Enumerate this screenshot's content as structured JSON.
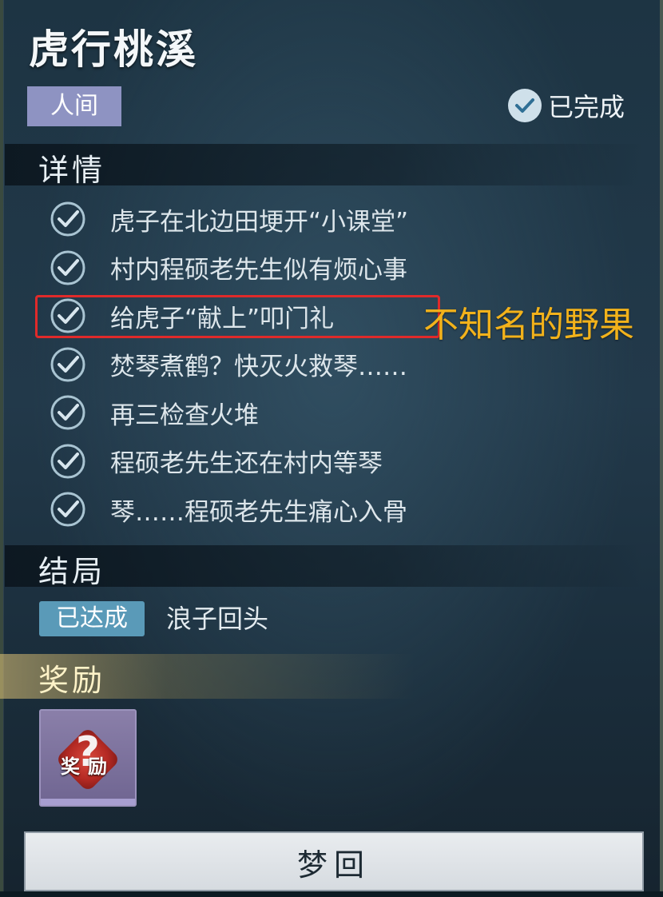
{
  "quest": {
    "title": "虎行桃溪",
    "category_tag": "人间",
    "status_label": "已完成"
  },
  "details": {
    "heading": "详情",
    "tasks": [
      {
        "text": "虎子在北边田埂开“小课堂”",
        "done": true
      },
      {
        "text": "村内程硕老先生似有烦心事",
        "done": true
      },
      {
        "text": "给虎子“献上”叩门礼",
        "done": true
      },
      {
        "text": "焚琴煮鹤？快灭火救琴……",
        "done": true
      },
      {
        "text": "再三检查火堆",
        "done": true
      },
      {
        "text": "程硕老先生还在村内等琴",
        "done": true
      },
      {
        "text": "琴……程硕老先生痛心入骨",
        "done": true
      }
    ]
  },
  "annotation": {
    "text": "不知名的野果",
    "highlight_color": "#e02a2a",
    "text_color": "#f2b21b"
  },
  "ending": {
    "heading": "结局",
    "badge": "已达成",
    "name": "浪子回头"
  },
  "reward": {
    "heading": "奖励",
    "item_label": "奖励",
    "item_icon": "question-mark-diamond-icon"
  },
  "footer": {
    "button_label": "梦回"
  }
}
